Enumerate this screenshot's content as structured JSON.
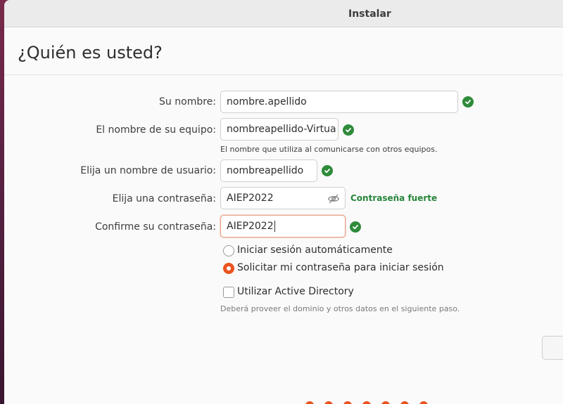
{
  "window": {
    "title": "Instalar"
  },
  "page": {
    "title": "¿Quién es usted?"
  },
  "form": {
    "name": {
      "label": "Su nombre:",
      "value": "nombre.apellido"
    },
    "computer": {
      "label": "El nombre de su equipo:",
      "value": "nombreapellido-Virtua",
      "hint": "El nombre que utiliza al comunicarse con otros equipos."
    },
    "username": {
      "label": "Elija un nombre de usuario:",
      "value": "nombreapellido"
    },
    "password": {
      "label": "Elija una contraseña:",
      "value": "AIEP2022",
      "strength": "Contraseña fuerte"
    },
    "confirm": {
      "label": "Confirme su contraseña:",
      "value": "AIEP2022"
    }
  },
  "login_options": {
    "auto_login": {
      "label": "Iniciar sesión automáticamente",
      "selected": false
    },
    "require_password": {
      "label": "Solicitar mi contraseña para iniciar sesión",
      "selected": true
    }
  },
  "active_directory": {
    "label": "Utilizar Active Directory",
    "checked": false,
    "hint": "Deberá proveer el dominio y otros datos en el siguiente paso."
  },
  "progress": {
    "steps": 7
  },
  "icons": {
    "valid": "check-circle-icon",
    "toggle_visibility": "eye-slash-icon"
  },
  "colors": {
    "accent": "#e95420",
    "success": "#2e8b3a"
  }
}
